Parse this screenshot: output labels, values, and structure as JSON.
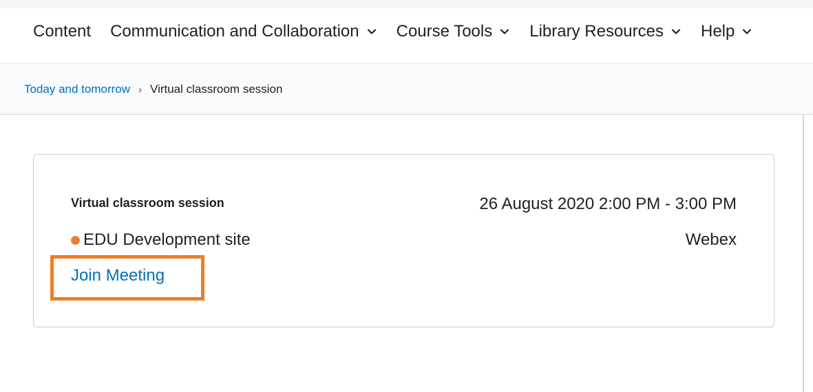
{
  "nav": {
    "items": [
      {
        "label": "Content",
        "has_dropdown": false
      },
      {
        "label": "Communication and Collaboration",
        "has_dropdown": true
      },
      {
        "label": "Course Tools",
        "has_dropdown": true
      },
      {
        "label": "Library Resources",
        "has_dropdown": true
      },
      {
        "label": "Help",
        "has_dropdown": true
      }
    ]
  },
  "breadcrumb": {
    "link": "Today and tomorrow",
    "separator": "›",
    "current": "Virtual classroom session"
  },
  "event": {
    "title": "Virtual classroom session",
    "time": "26 August 2020 2:00 PM - 3:00 PM",
    "org": "EDU Development site",
    "provider": "Webex",
    "join_label": "Join Meeting"
  },
  "colors": {
    "link": "#006fbf",
    "highlight": "#ef7d22",
    "org_dot": "#e87d3e"
  }
}
